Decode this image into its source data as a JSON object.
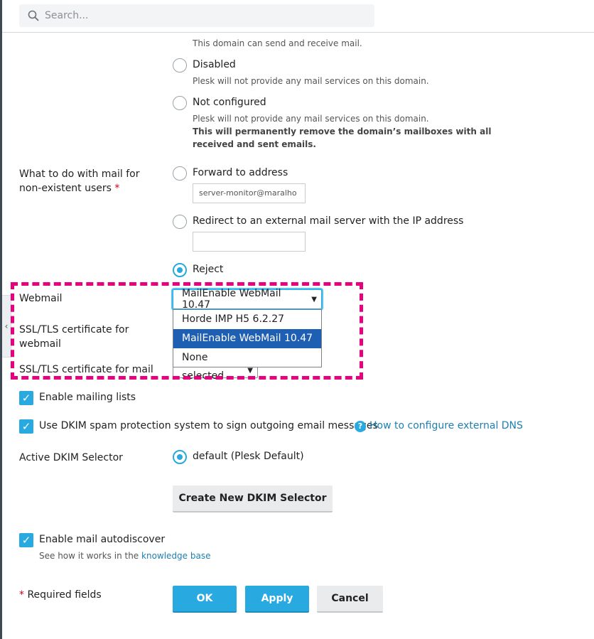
{
  "search": {
    "placeholder": "Search..."
  },
  "mail_service": {
    "enabled_hint": "This domain can send and receive mail.",
    "disabled_label": "Disabled",
    "disabled_hint": "Plesk will not provide any mail services on this domain.",
    "not_configured_label": "Not configured",
    "not_configured_hint": "Plesk will not provide any mail services on this domain.",
    "not_configured_warning": "This will permanently remove the domain’s mailboxes with all received and sent emails."
  },
  "nonexistent": {
    "label": "What to do with mail for non-existent users",
    "required_mark": "*",
    "forward_label": "Forward to address",
    "forward_value": "server-monitor@maralho",
    "redirect_label": "Redirect to an external mail server with the IP address",
    "redirect_value": "",
    "reject_label": "Reject"
  },
  "webmail": {
    "label": "Webmail",
    "selected": "MailEnable WebMail 10.47",
    "options": [
      "Horde IMP H5 6.2.27",
      "MailEnable WebMail 10.47",
      "None"
    ]
  },
  "ssl_webmail": {
    "label": "SSL/TLS certificate for webmail"
  },
  "ssl_mail": {
    "label": "SSL/TLS certificate for mail",
    "selected": "Not selected"
  },
  "mailing_lists": {
    "label": "Enable mailing lists",
    "checked": true
  },
  "dkim": {
    "label": "Use DKIM spam protection system to sign outgoing email messages",
    "help_link": "How to configure external DNS",
    "checked": true
  },
  "dkim_selector": {
    "label": "Active DKIM Selector",
    "option": "default (Plesk Default)",
    "create_button": "Create New DKIM Selector"
  },
  "autodiscover": {
    "label": "Enable mail autodiscover",
    "hint_prefix": "See how it works in the",
    "hint_link": "knowledge base",
    "checked": true
  },
  "footer": {
    "required_mark": "*",
    "required_text": "Required fields",
    "ok": "OK",
    "apply": "Apply",
    "cancel": "Cancel"
  },
  "colors": {
    "accent": "#28a9e0",
    "highlight": "#e6007e",
    "selection": "#1e5fb4"
  }
}
